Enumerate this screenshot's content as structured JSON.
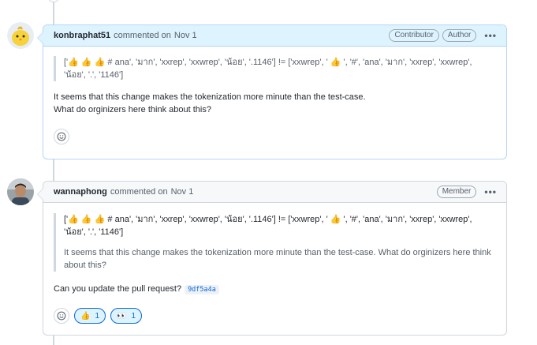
{
  "comments": [
    {
      "author": "konbraphat51",
      "action": "commented on",
      "date": "Nov 1",
      "badges": [
        "Contributor",
        "Author"
      ],
      "quote": [],
      "code": "['👍 👍 👍 # ana', 'มาก', 'xxrep', 'xxwrep', 'น้อย', '.1146'] != ['xxwrep', ' 👍 ', '#', 'ana', 'มาก', 'xxrep', 'xxwrep', 'น้อย', '.', '1146']",
      "text_lines": [
        "It seems that this change makes the tokenization more minute than the test-case.",
        "What do orginizers here think about this?"
      ]
    },
    {
      "author": "wannaphong",
      "action": "commented on",
      "date": "Nov 1",
      "badges": [
        "Member"
      ],
      "quote_code": "['👍 👍 👍 # ana', 'มาก', 'xxrep', 'xxwrep', 'น้อย', '.1146'] != ['xxwrep', ' 👍 ', '#', 'ana', 'มาก', 'xxrep', 'xxwrep', 'น้อย', '.', '1146']",
      "quote_text": "It seems that this change makes the tokenization more minute than the test-case. What do orginizers here think about this?",
      "text": "Can you update the pull request?",
      "commit_sha": "9df5a4a",
      "reactions": [
        {
          "emoji": "👍",
          "count": "1"
        },
        {
          "emoji": "👀",
          "count": "1"
        }
      ]
    }
  ],
  "icons": {
    "kebab": "kebab-horizontal-icon",
    "smiley": "smiley-icon"
  },
  "colors": {
    "author_header_bg": "#ddf4ff",
    "author_border": "#b6d6f5",
    "link": "#0969da",
    "reaction_bg": "#ddf4ff"
  }
}
